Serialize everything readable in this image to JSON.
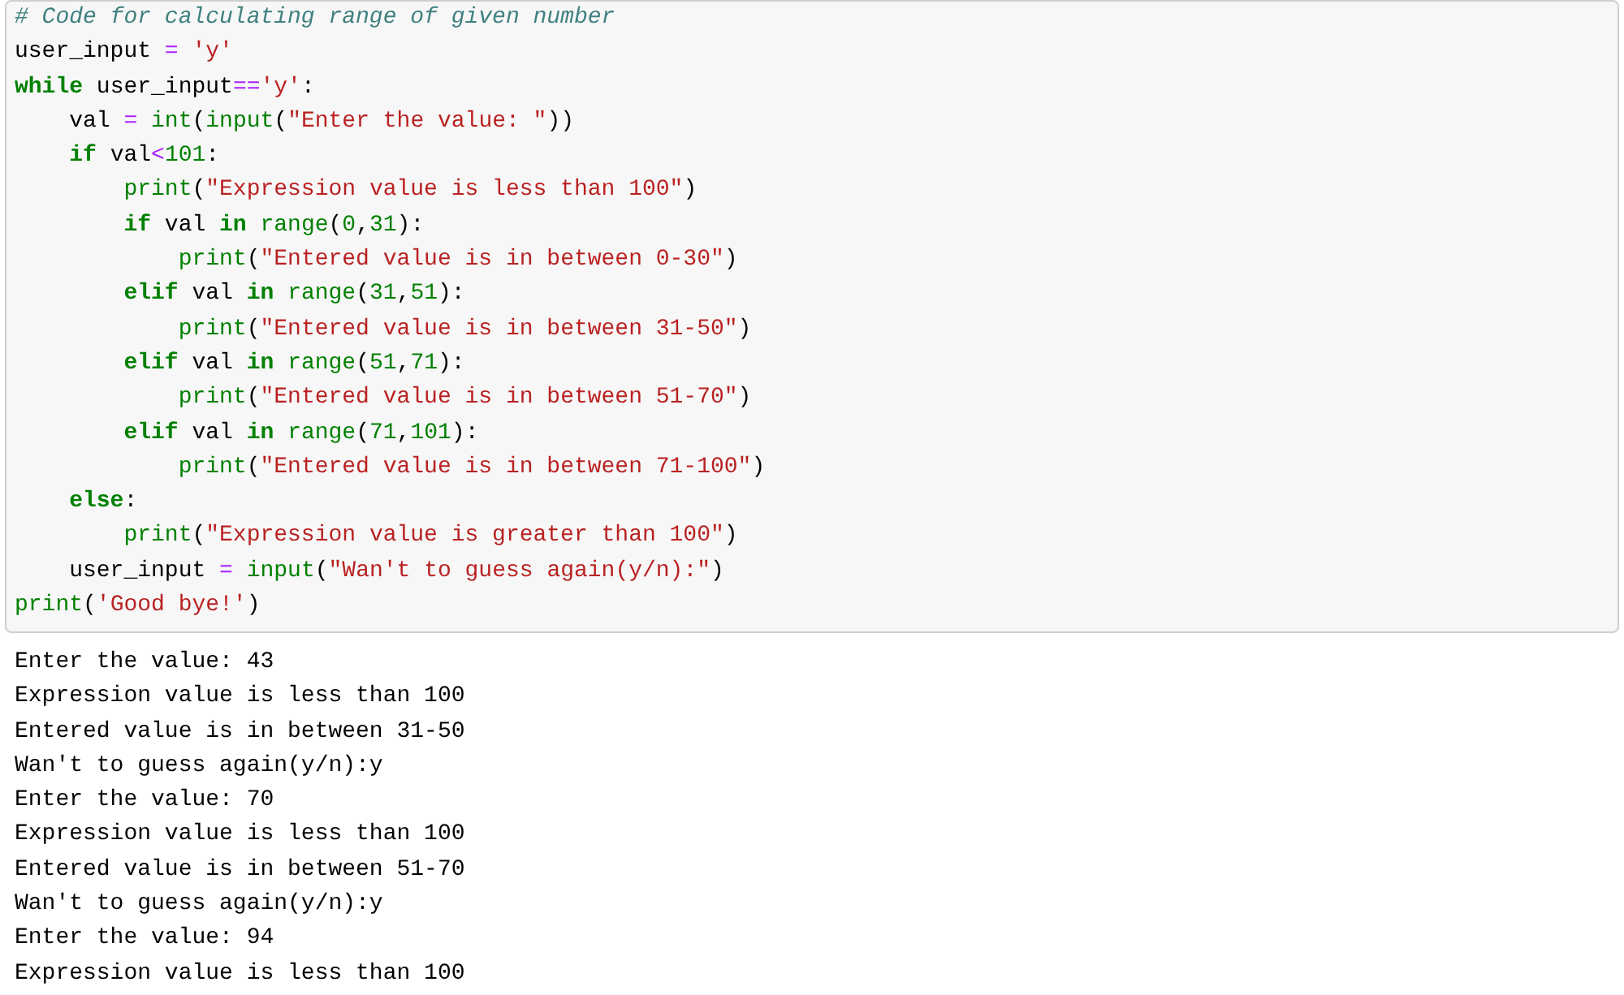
{
  "code_cell": {
    "lines": [
      [
        {
          "kind": "comment",
          "text": "# Code for calculating range of given number"
        }
      ],
      [
        {
          "kind": "plain",
          "text": "user_input "
        },
        {
          "kind": "operator",
          "text": "= "
        },
        {
          "kind": "string",
          "text": "'y'"
        }
      ],
      [
        {
          "kind": "keyword",
          "text": "while"
        },
        {
          "kind": "plain",
          "text": " user_input"
        },
        {
          "kind": "operator",
          "text": "=="
        },
        {
          "kind": "string",
          "text": "'y'"
        },
        {
          "kind": "plain",
          "text": ":"
        }
      ],
      [
        {
          "kind": "plain",
          "text": "    val "
        },
        {
          "kind": "operator",
          "text": "= "
        },
        {
          "kind": "builtin",
          "text": "int"
        },
        {
          "kind": "plain",
          "text": "("
        },
        {
          "kind": "builtin",
          "text": "input"
        },
        {
          "kind": "plain",
          "text": "("
        },
        {
          "kind": "string",
          "text": "\"Enter the value: \""
        },
        {
          "kind": "plain",
          "text": "))"
        }
      ],
      [
        {
          "kind": "keyword",
          "text": "    if"
        },
        {
          "kind": "plain",
          "text": " val"
        },
        {
          "kind": "operator",
          "text": "<"
        },
        {
          "kind": "number",
          "text": "101"
        },
        {
          "kind": "plain",
          "text": ":"
        }
      ],
      [
        {
          "kind": "builtin",
          "text": "        print"
        },
        {
          "kind": "plain",
          "text": "("
        },
        {
          "kind": "string",
          "text": "\"Expression value is less than 100\""
        },
        {
          "kind": "plain",
          "text": ")"
        }
      ],
      [
        {
          "kind": "keyword",
          "text": "        if"
        },
        {
          "kind": "plain",
          "text": " val "
        },
        {
          "kind": "keyword",
          "text": "in "
        },
        {
          "kind": "builtin",
          "text": "range"
        },
        {
          "kind": "plain",
          "text": "("
        },
        {
          "kind": "number",
          "text": "0"
        },
        {
          "kind": "plain",
          "text": ","
        },
        {
          "kind": "number",
          "text": "31"
        },
        {
          "kind": "plain",
          "text": "):"
        }
      ],
      [
        {
          "kind": "builtin",
          "text": "            print"
        },
        {
          "kind": "plain",
          "text": "("
        },
        {
          "kind": "string",
          "text": "\"Entered value is in between 0-30\""
        },
        {
          "kind": "plain",
          "text": ")"
        }
      ],
      [
        {
          "kind": "keyword",
          "text": "        elif"
        },
        {
          "kind": "plain",
          "text": " val "
        },
        {
          "kind": "keyword",
          "text": "in "
        },
        {
          "kind": "builtin",
          "text": "range"
        },
        {
          "kind": "plain",
          "text": "("
        },
        {
          "kind": "number",
          "text": "31"
        },
        {
          "kind": "plain",
          "text": ","
        },
        {
          "kind": "number",
          "text": "51"
        },
        {
          "kind": "plain",
          "text": "):"
        }
      ],
      [
        {
          "kind": "builtin",
          "text": "            print"
        },
        {
          "kind": "plain",
          "text": "("
        },
        {
          "kind": "string",
          "text": "\"Entered value is in between 31-50\""
        },
        {
          "kind": "plain",
          "text": ")"
        }
      ],
      [
        {
          "kind": "keyword",
          "text": "        elif"
        },
        {
          "kind": "plain",
          "text": " val "
        },
        {
          "kind": "keyword",
          "text": "in "
        },
        {
          "kind": "builtin",
          "text": "range"
        },
        {
          "kind": "plain",
          "text": "("
        },
        {
          "kind": "number",
          "text": "51"
        },
        {
          "kind": "plain",
          "text": ","
        },
        {
          "kind": "number",
          "text": "71"
        },
        {
          "kind": "plain",
          "text": "):"
        }
      ],
      [
        {
          "kind": "builtin",
          "text": "            print"
        },
        {
          "kind": "plain",
          "text": "("
        },
        {
          "kind": "string",
          "text": "\"Entered value is in between 51-70\""
        },
        {
          "kind": "plain",
          "text": ")"
        }
      ],
      [
        {
          "kind": "keyword",
          "text": "        elif"
        },
        {
          "kind": "plain",
          "text": " val "
        },
        {
          "kind": "keyword",
          "text": "in "
        },
        {
          "kind": "builtin",
          "text": "range"
        },
        {
          "kind": "plain",
          "text": "("
        },
        {
          "kind": "number",
          "text": "71"
        },
        {
          "kind": "plain",
          "text": ","
        },
        {
          "kind": "number",
          "text": "101"
        },
        {
          "kind": "plain",
          "text": "):"
        }
      ],
      [
        {
          "kind": "builtin",
          "text": "            print"
        },
        {
          "kind": "plain",
          "text": "("
        },
        {
          "kind": "string",
          "text": "\"Entered value is in between 71-100\""
        },
        {
          "kind": "plain",
          "text": ")"
        }
      ],
      [
        {
          "kind": "keyword",
          "text": "    else"
        },
        {
          "kind": "plain",
          "text": ":"
        }
      ],
      [
        {
          "kind": "builtin",
          "text": "        print"
        },
        {
          "kind": "plain",
          "text": "("
        },
        {
          "kind": "string",
          "text": "\"Expression value is greater than 100\""
        },
        {
          "kind": "plain",
          "text": ")"
        }
      ],
      [
        {
          "kind": "plain",
          "text": "    user_input "
        },
        {
          "kind": "operator",
          "text": "= "
        },
        {
          "kind": "builtin",
          "text": "input"
        },
        {
          "kind": "plain",
          "text": "("
        },
        {
          "kind": "string",
          "text": "\"Wan't to guess again(y/n):\""
        },
        {
          "kind": "plain",
          "text": ")"
        }
      ],
      [
        {
          "kind": "builtin",
          "text": "print"
        },
        {
          "kind": "plain",
          "text": "("
        },
        {
          "kind": "string",
          "text": "'Good bye!'"
        },
        {
          "kind": "plain",
          "text": ")"
        }
      ]
    ]
  },
  "output": {
    "lines": [
      "Enter the value: 43",
      "Expression value is less than 100",
      "Entered value is in between 31-50",
      "Wan't to guess again(y/n):y",
      "Enter the value: 70",
      "Expression value is less than 100",
      "Entered value is in between 51-70",
      "Wan't to guess again(y/n):y",
      "Enter the value: 94",
      "Expression value is less than 100"
    ]
  }
}
